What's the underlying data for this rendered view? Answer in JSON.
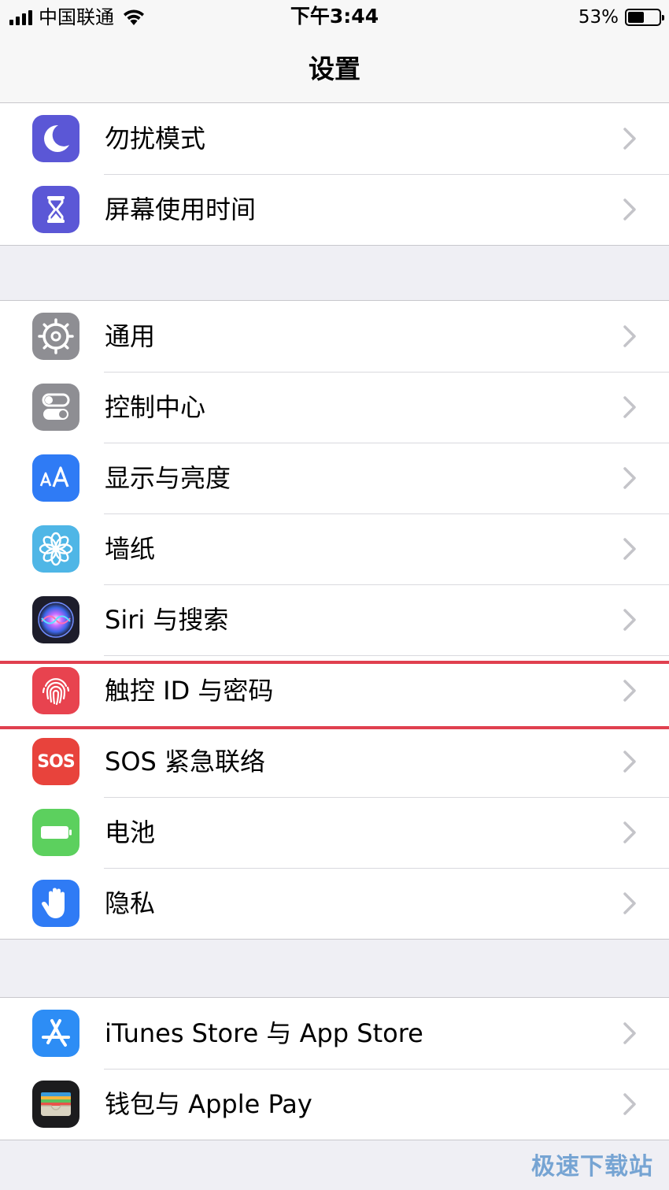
{
  "status_bar": {
    "carrier": "中国联通",
    "time": "下午3:44",
    "battery_percent_label": "53%",
    "battery_level": 0.53
  },
  "nav": {
    "title": "设置"
  },
  "groups": [
    {
      "rows": [
        {
          "label": "勿扰模式",
          "icon": "moon-icon",
          "color": "#5b57d6"
        },
        {
          "label": "屏幕使用时间",
          "icon": "hourglass-icon",
          "color": "#5b57d6"
        }
      ]
    },
    {
      "rows": [
        {
          "label": "通用",
          "icon": "gear-icon",
          "color": "#8e8e93"
        },
        {
          "label": "控制中心",
          "icon": "toggles-icon",
          "color": "#8e8e93"
        },
        {
          "label": "显示与亮度",
          "icon": "text-size-icon",
          "color": "#2f7bf5"
        },
        {
          "label": "墙纸",
          "icon": "flower-icon",
          "color": "#4fb6e6"
        },
        {
          "label": "Siri 与搜索",
          "icon": "siri-icon",
          "color": "#1d1d2b"
        },
        {
          "label": "触控 ID 与密码",
          "icon": "fingerprint-icon",
          "color": "#e8434f"
        },
        {
          "label": "SOS 紧急联络",
          "icon": "sos-icon",
          "icon_text": "SOS",
          "color": "#e8433c"
        },
        {
          "label": "电池",
          "icon": "battery-icon",
          "color": "#5cd05e"
        },
        {
          "label": "隐私",
          "icon": "hand-icon",
          "color": "#2f7bf5"
        }
      ]
    },
    {
      "rows": [
        {
          "label": "iTunes Store 与 App Store",
          "icon": "app-store-icon",
          "color": "#2d8df5"
        },
        {
          "label": "钱包与 Apple Pay",
          "icon": "wallet-icon",
          "color": "#1c1c1e"
        }
      ]
    }
  ],
  "watermark": "极速下载站"
}
